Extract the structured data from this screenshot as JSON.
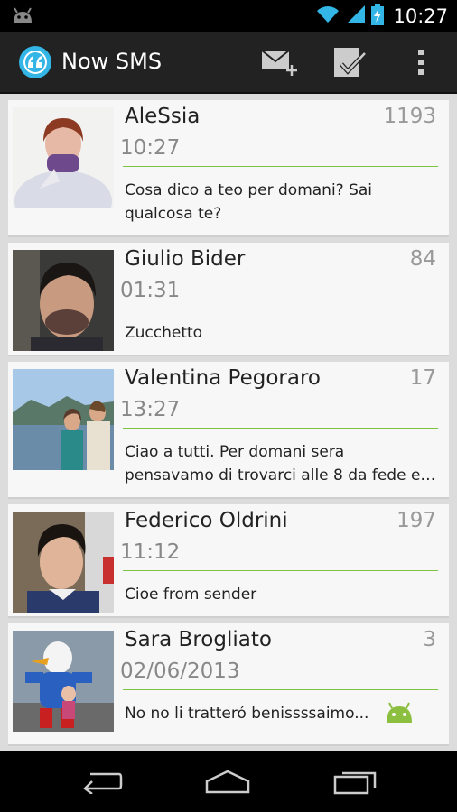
{
  "status_bar": {
    "time": "10:27"
  },
  "action_bar": {
    "title": "Now SMS",
    "icons": [
      "new-message-icon",
      "mark-read-icon",
      "overflow-menu-icon"
    ]
  },
  "conversations": [
    {
      "name": "AleSsia",
      "count": "1193",
      "time": "10:27",
      "message": "Cosa dico a teo per domani? Sai qualcosa te?"
    },
    {
      "name": "Giulio Bider",
      "count": "84",
      "time": "01:31",
      "message": "Zucchetto"
    },
    {
      "name": "Valentina Pegoraro",
      "count": "17",
      "time": "13:27",
      "message": "Ciao a tutti.  Per domani sera pensavamo di trovarci alle 8 da fede e…"
    },
    {
      "name": "Federico Oldrini",
      "count": "197",
      "time": "11:12",
      "message": "Cioe from sender"
    },
    {
      "name": "Sara Brogliato",
      "count": "3",
      "time": "02/06/2013",
      "message": "No no li tratteró benissssaimo..."
    }
  ],
  "colors": {
    "accent": "#7dc242",
    "logo": "#33b5e5",
    "action_bar": "#222222"
  }
}
